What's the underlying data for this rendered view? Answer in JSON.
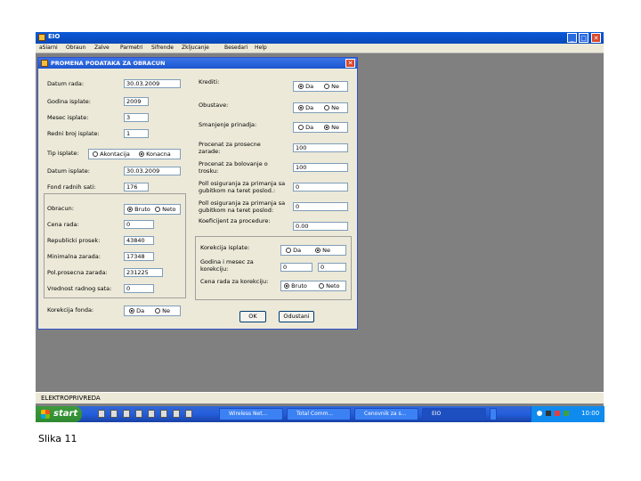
{
  "window": {
    "title": "EIO"
  },
  "menu": [
    "aSiarni",
    "Obraun",
    "Zalve",
    "Parmetri",
    "Sifrende",
    "Zkljucanje",
    "Besedari",
    "Help"
  ],
  "dialog": {
    "title": "PROMENA PODATAKA ZA OBRACUN",
    "close_glyph": "✕",
    "left": {
      "datum_rada": {
        "label": "Datum rada:",
        "value": "30.03.2009"
      },
      "godina_isplate": {
        "label": "Godina isplate:",
        "value": "2009"
      },
      "mesec_isplate": {
        "label": "Mesec isplate:",
        "value": "3"
      },
      "redni_broj_isplate": {
        "label": "Redni broj isplate:",
        "value": "1"
      },
      "tip_isplate": {
        "label": "Tip isplate:",
        "opt1": "Akontacija",
        "opt2": "Konacna"
      },
      "datum_isplate": {
        "label": "Datum isplate:",
        "value": "30.03.2009"
      },
      "fond_radnih_sati": {
        "label": "Fond radnih sati:",
        "value": "176"
      },
      "obracun": {
        "label": "Obracun:",
        "opt1": "Bruto",
        "opt2": "Neto"
      },
      "cena_rada": {
        "label": "Cena rada:",
        "value": "0"
      },
      "republicki_prosek": {
        "label": "Republicki prosek:",
        "value": "43840"
      },
      "minimalna_zarada": {
        "label": "Minimalna zarada:",
        "value": "17348"
      },
      "poslednja_zarada": {
        "label": "Pol.prosecna zarada:",
        "value": "231225"
      },
      "vrednost_radnog_sata": {
        "label": "Vrednost radnog sata:",
        "value": "0"
      },
      "korekcija_fonda": {
        "label": "Korekcija fonda:",
        "opt1": "Da",
        "opt2": "Ne"
      }
    },
    "right": {
      "krediti": {
        "label": "Krediti:",
        "opt1": "Da",
        "opt2": "Ne"
      },
      "obustave": {
        "label": "Obustave:",
        "opt1": "Da",
        "opt2": "Ne"
      },
      "smanjenje_prinadja": {
        "label": "Smanjenje prinadja:",
        "opt1": "Da",
        "opt2": "Ne"
      },
      "procenat_rada": {
        "label": "Procenat za prosecne zarade:",
        "value": "100"
      },
      "procenat_bolovanje": {
        "label": "Procenat za bolovanje o trosku:",
        "value": "100"
      },
      "pol_prinadja": {
        "label": "Poll osiguranja za primanja sa gubitkom na teret poslod.:",
        "value": "0"
      },
      "pol_pred": {
        "label": "Poll osiguranja za primanja sa gubitkom na teret poslod:",
        "value": "0"
      },
      "koeficijent": {
        "label": "Koeficijent za procedure:",
        "value": "0.00"
      },
      "korekcija_isplate": {
        "label": "Korekcija isplate:",
        "opt1": "Da",
        "opt2": "Ne"
      },
      "godina_mesec": {
        "label": "Godina i mesec za korekciju:",
        "value1": "0",
        "value2": "0"
      },
      "cena_rada_korekcija": {
        "label": "Cena rada za korekciju:",
        "opt1": "Bruto",
        "opt2": "Neto"
      }
    },
    "buttons": {
      "ok": "OK",
      "cancel": "Odustani"
    }
  },
  "statusbar": {
    "text": "ELEKTROPRIVREDA"
  },
  "taskbar": {
    "start": "start",
    "tasks": [
      "Wireless Net...",
      "Total Comm...",
      "Cenovnik za s...",
      "EIO",
      ""
    ],
    "clock": "10:00"
  },
  "caption": "Slika 11"
}
